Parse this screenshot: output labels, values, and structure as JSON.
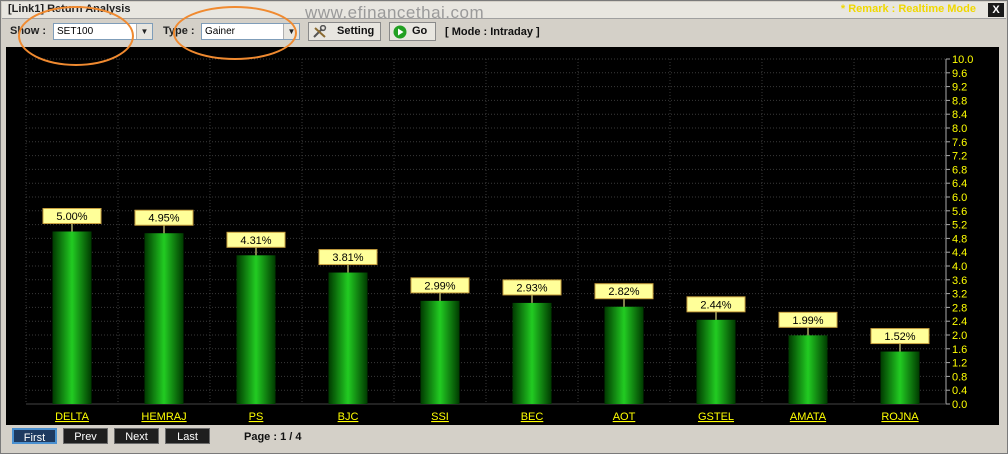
{
  "window": {
    "title": "[Link1] Return Analysis",
    "watermark": "www.efinancethai.com",
    "remark": "* Remark : Realtime Mode",
    "close_label": "X"
  },
  "toolbar": {
    "show_label": "Show :",
    "show_value": "SET100",
    "type_label": "Type :",
    "type_value": "Gainer",
    "setting_label": "Setting",
    "go_label": "Go",
    "mode_text": "[ Mode : Intraday ]",
    "setting_icon": "tools-icon",
    "go_icon": "play-icon"
  },
  "footer": {
    "first_label": "First",
    "prev_label": "Prev",
    "next_label": "Next",
    "last_label": "Last",
    "page_text": "Page : 1 / 4"
  },
  "colors": {
    "background": "#000000",
    "bar": "#22cc22",
    "label_fill": "#ffff99",
    "tick_text": "#ffff00",
    "category_text": "#ffff00",
    "highlight": "#f08a30"
  },
  "chart_data": {
    "type": "bar",
    "categories": [
      "DELTA",
      "HEMRAJ",
      "PS",
      "BJC",
      "SSI",
      "BEC",
      "AOT",
      "GSTEL",
      "AMATA",
      "ROJNA"
    ],
    "values": [
      5.0,
      4.95,
      4.31,
      3.81,
      2.99,
      2.93,
      2.82,
      2.44,
      1.99,
      1.52
    ],
    "value_labels": [
      "5.00%",
      "4.95%",
      "4.31%",
      "3.81%",
      "2.99%",
      "2.93%",
      "2.82%",
      "2.44%",
      "1.99%",
      "1.52%"
    ],
    "ylim": [
      0,
      10
    ],
    "ytick_step": 0.4,
    "ytick_labels": [
      "0.0",
      "0.4",
      "0.8",
      "1.2",
      "1.6",
      "2.0",
      "2.4",
      "2.8",
      "3.2",
      "3.6",
      "4.0",
      "4.4",
      "4.8",
      "5.2",
      "5.6",
      "6.0",
      "6.4",
      "6.8",
      "7.2",
      "7.6",
      "8.0",
      "8.4",
      "8.8",
      "9.2",
      "9.6",
      "10.0"
    ],
    "y_axis_side": "right",
    "grid": true
  }
}
